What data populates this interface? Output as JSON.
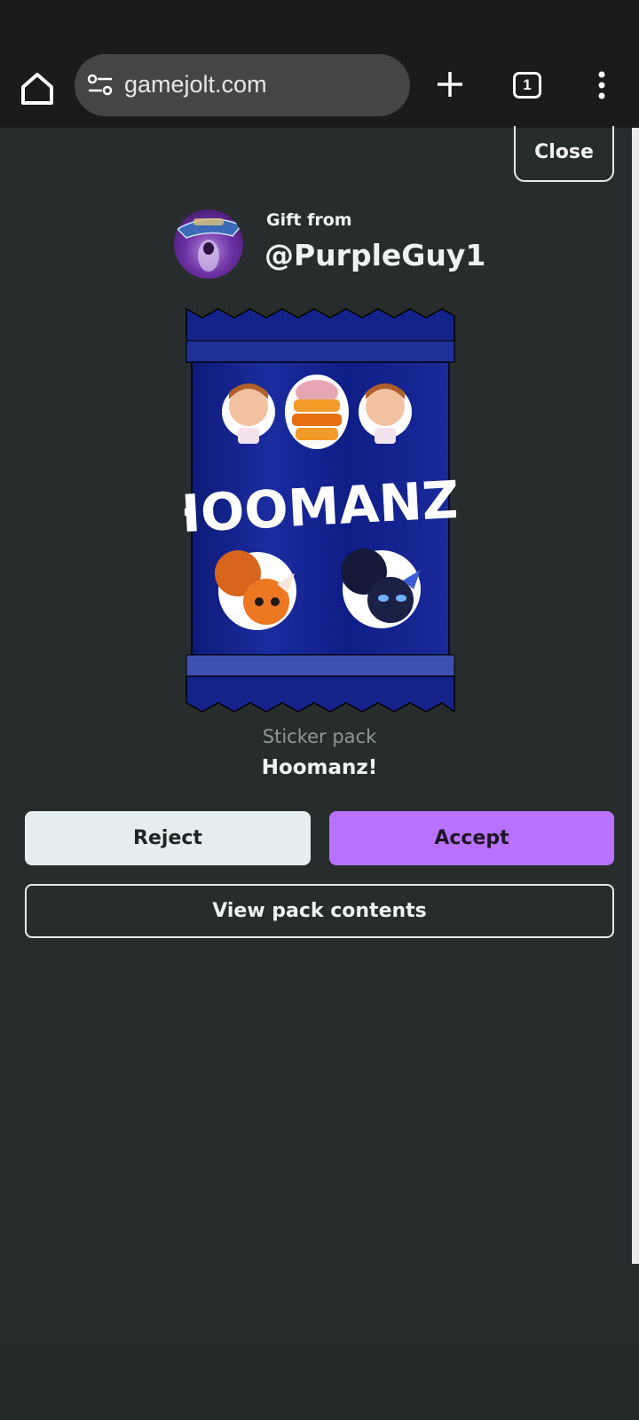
{
  "browser": {
    "url": "gamejolt.com",
    "tab_count": "1",
    "icons": [
      "home-icon",
      "site-settings-icon",
      "new-tab-icon",
      "tab-switcher-icon",
      "more-menu-icon"
    ]
  },
  "modal": {
    "close_label": "Close",
    "gift_label": "Gift from",
    "sender": "@PurpleGuy1",
    "pack_kind": "Sticker pack",
    "pack_name": "Hoomanz!",
    "pack_art_text": "HOOMANZ!",
    "reject_label": "Reject",
    "accept_label": "Accept",
    "view_label": "View pack contents"
  },
  "colors": {
    "background": "#272d2d",
    "accept": "#b872ff",
    "reject": "#e5eeee",
    "pack_blue": "#12208a"
  }
}
